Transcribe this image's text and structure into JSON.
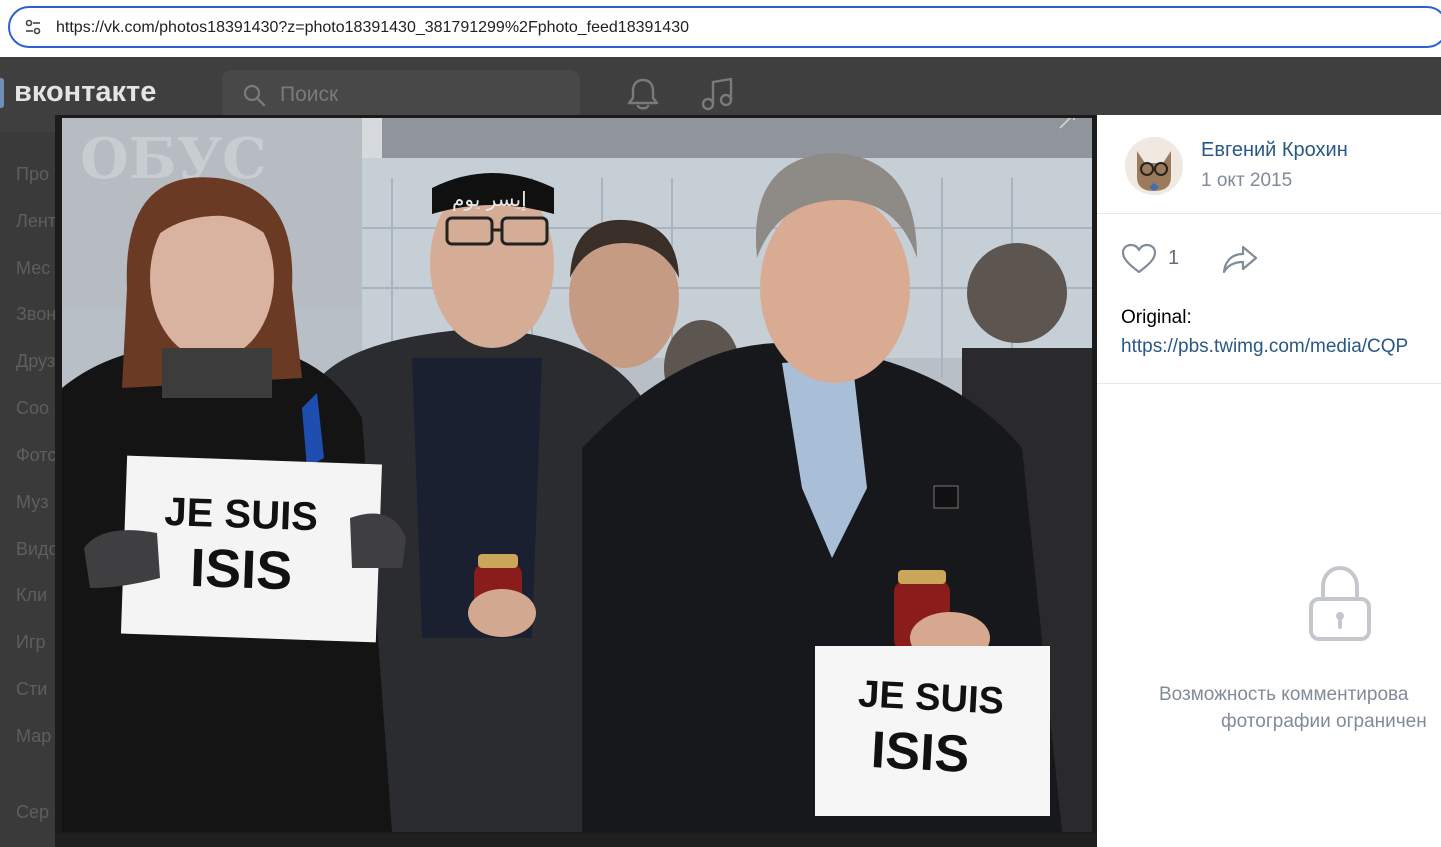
{
  "browser": {
    "url": "https://vk.com/photos18391430?z=photo18391430_381791299%2Fphoto_feed18391430"
  },
  "vk": {
    "logo": "вконтакте",
    "search_placeholder": "Поиск",
    "sidebar_fragments": [
      "Про",
      "Лент",
      "Мес",
      "Звон",
      "Друз",
      "Соо",
      "Фото",
      "Муз",
      "Видо",
      "Кли",
      "Игр",
      "Сти",
      "Мар",
      "Сер"
    ]
  },
  "photo": {
    "sign_left_line1": "JE SUIS",
    "sign_left_line2": "ISIS",
    "sign_right_line1": "JE SUIS",
    "sign_right_line2": "ISIS",
    "headband_text": "ﺇﻳﺴﺮ ﻳﻮﻡ"
  },
  "panel": {
    "author": "Евгений Крохин",
    "date": "1 окт 2015",
    "likes": "1",
    "description_label": "Original:",
    "description_link": "https://pbs.twimg.com/media/CQP",
    "comments_restricted_line1": "Возможность комментирова",
    "comments_restricted_line2": "фотографии ограничен"
  },
  "colors": {
    "link": "#2a5885",
    "secondary_text": "#818c99",
    "url_border": "#2f5fd0"
  }
}
